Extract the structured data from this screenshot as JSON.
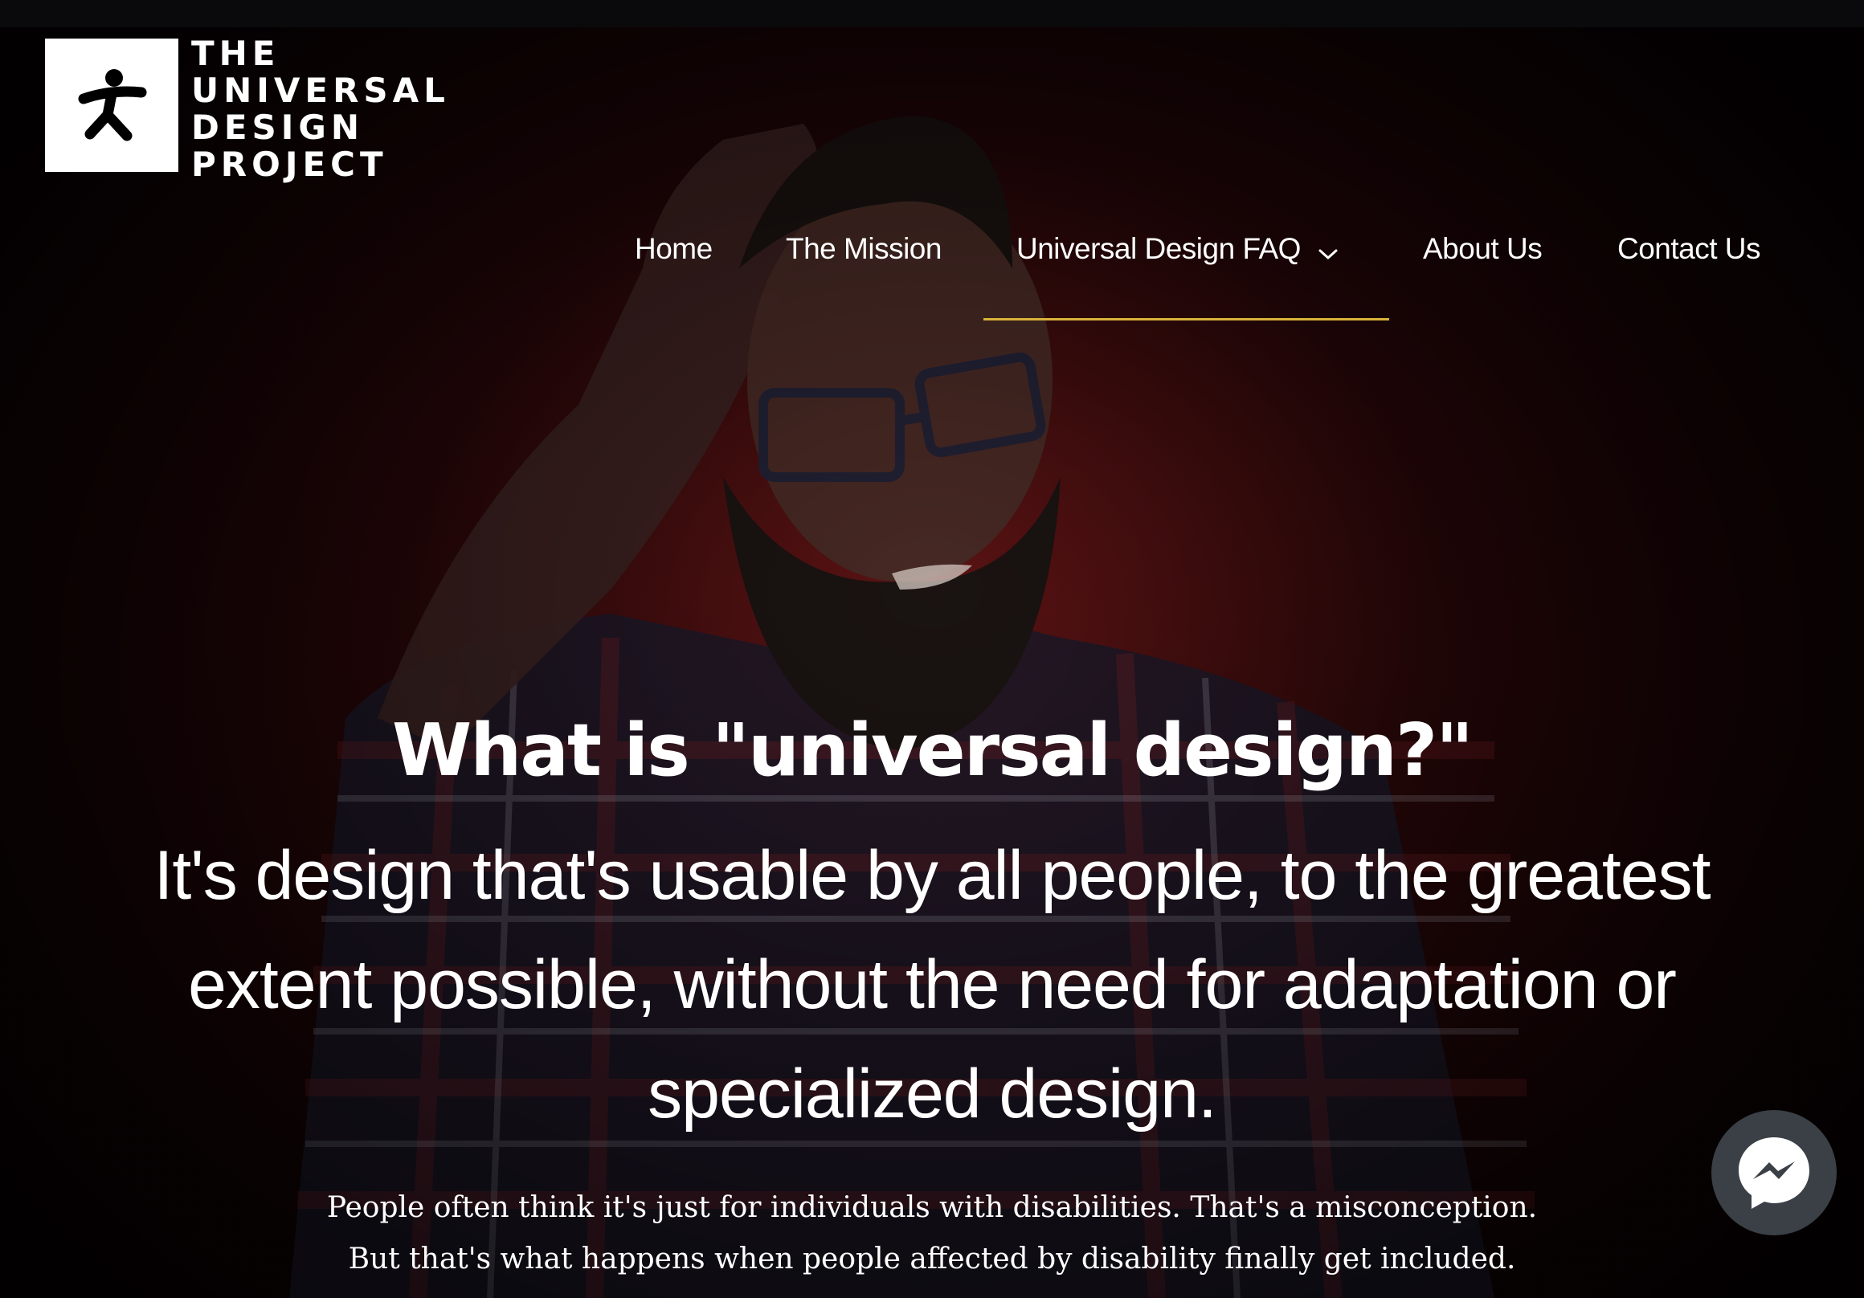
{
  "logo": {
    "lines": [
      "THE",
      "UNIVERSAL",
      "DESIGN",
      "PROJECT"
    ],
    "icon": "person-figure-icon"
  },
  "nav": {
    "items": [
      {
        "label": "Home"
      },
      {
        "label": "The Mission"
      },
      {
        "label": "Universal Design FAQ",
        "icon": "chevron-down-icon"
      },
      {
        "label": "About Us"
      },
      {
        "label": "Contact Us"
      }
    ],
    "active_index": 2,
    "accent_color": "#d9b23a"
  },
  "hero": {
    "headline": "What is \"universal design?\"",
    "subhead": "It's design that's usable by all people, to the greatest extent possible, without the need for adaptation or specialized design.",
    "body_lines": [
      "People often think it's just for individuals with disabilities. That's a misconception.",
      "But that's what happens when people affected by disability finally get included."
    ]
  },
  "chat": {
    "icon": "messenger-icon"
  }
}
